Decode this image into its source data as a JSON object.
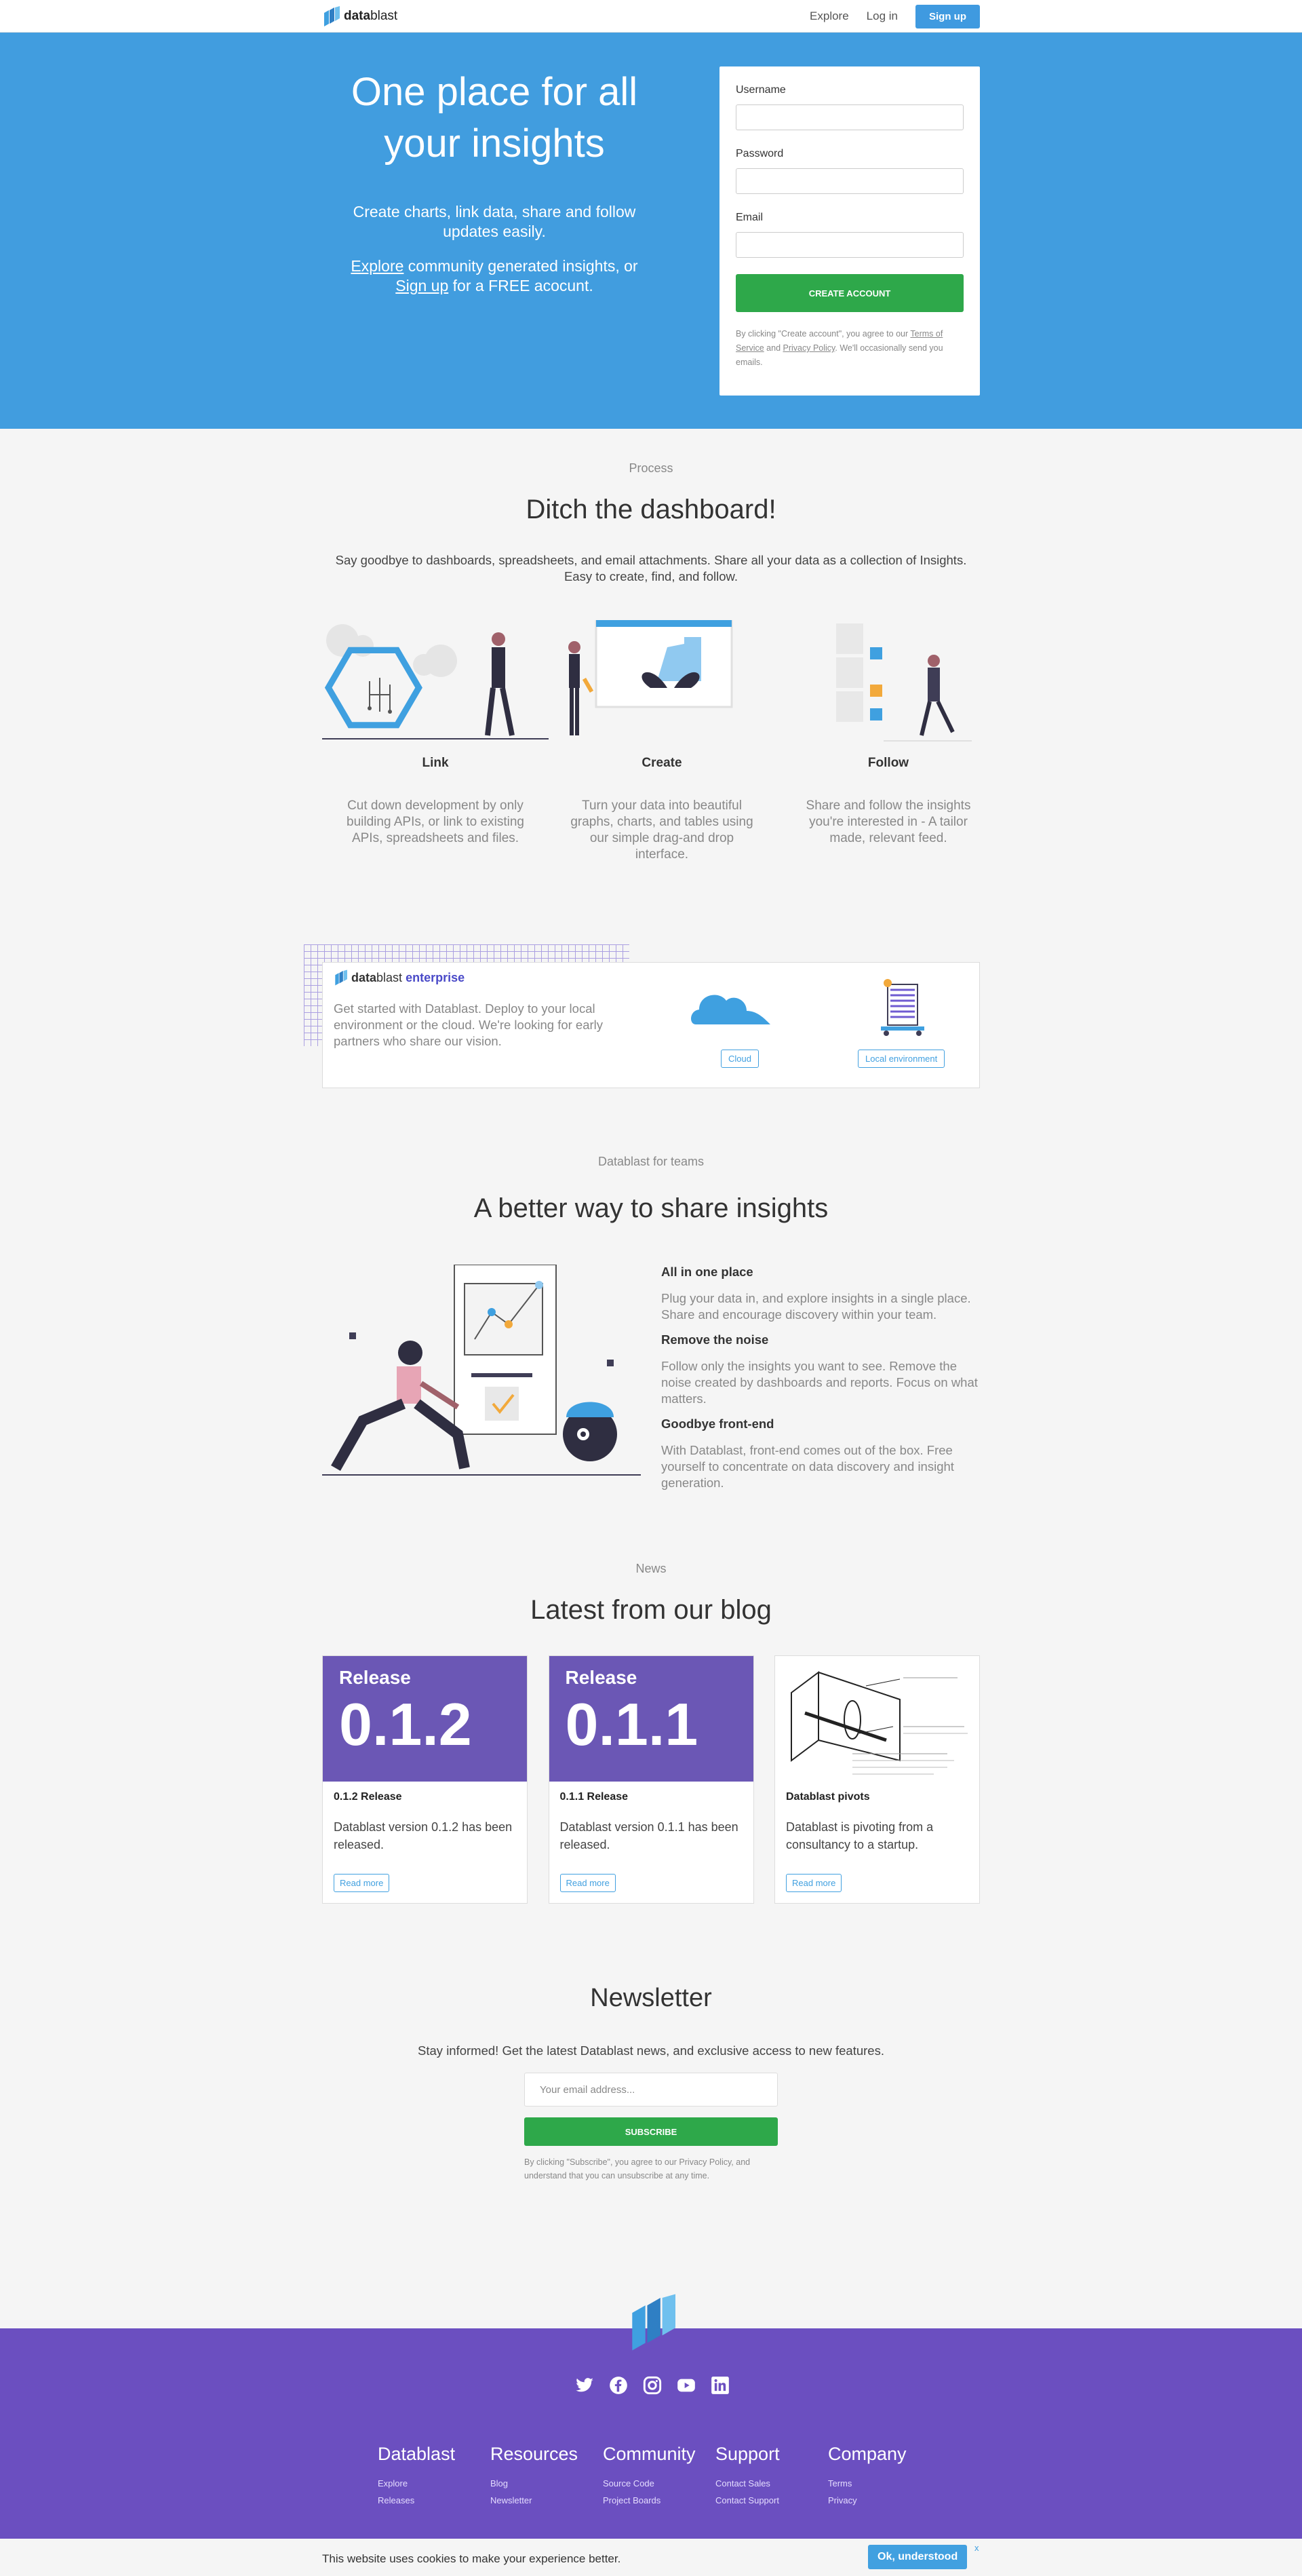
{
  "nav": {
    "brand_bold": "data",
    "brand_rest": "blast",
    "explore": "Explore",
    "login": "Log in",
    "signup": "Sign up"
  },
  "hero": {
    "title": "One place for all your insights",
    "subtitle": "Create charts, link data, share and follow updates easily.",
    "explore_link": "Explore",
    "text_mid": " community generated insights, or ",
    "signup_link": "Sign up",
    "text_end": " for a FREE acocunt."
  },
  "signup_form": {
    "username_label": "Username",
    "password_label": "Password",
    "email_label": "Email",
    "create_button": "CREATE ACCOUNT",
    "terms_pre": "By clicking \"Create account\", you agree to our ",
    "terms_link": "Terms of Service",
    "terms_and": " and ",
    "privacy_link": "Privacy Policy",
    "terms_post": ". We'll occasionally send you emails."
  },
  "process": {
    "eyebrow": "Process",
    "title": "Ditch the dashboard!",
    "lead": "Say goodbye to dashboards, spreadsheets, and email attachments. Share all your data as a collection of Insights. Easy to create, find, and follow.",
    "steps": [
      {
        "title": "Link",
        "text": "Cut down development by only building APIs, or link to existing APIs, spreadsheets and files."
      },
      {
        "title": "Create",
        "text": "Turn your data into beautiful graphs, charts, and tables using our simple drag-and drop interface."
      },
      {
        "title": "Follow",
        "text": "Share and follow the insights you're interested in - A tailor made, relevant feed."
      }
    ]
  },
  "enterprise": {
    "brand_bold": "data",
    "brand_rest": "blast",
    "tag": "enterprise",
    "text": "Get started with Datablast. Deploy to your local environment or the cloud. We're looking for early partners who share our vision.",
    "cloud_button": "Cloud",
    "local_button": "Local environment"
  },
  "teams": {
    "eyebrow": "Datablast for teams",
    "title": "A better way to share insights",
    "features": [
      {
        "title": "All in one place",
        "text": "Plug your data in, and explore insights in a single place. Share and encourage discovery within your team."
      },
      {
        "title": "Remove the noise",
        "text": "Follow only the insights you want to see. Remove the noise created by dashboards and reports. Focus on what matters."
      },
      {
        "title": "Goodbye front-end",
        "text": "With Datablast, front-end comes out of the box. Free yourself to concentrate on data discovery and insight generation."
      }
    ]
  },
  "news": {
    "eyebrow": "News",
    "title": "Latest from our blog",
    "posts": [
      {
        "badge": "Release",
        "version": "0.1.2",
        "title": "0.1.2 Release",
        "text": "Datablast version 0.1.2 has been released.",
        "button": "Read more"
      },
      {
        "badge": "Release",
        "version": "0.1.1",
        "title": "0.1.1 Release",
        "text": "Datablast version 0.1.1 has been released.",
        "button": "Read more"
      },
      {
        "title": "Datablast pivots",
        "text": "Datablast is pivoting from a consultancy to a startup.",
        "button": "Read more"
      }
    ]
  },
  "newsletter": {
    "title": "Newsletter",
    "lead": "Stay informed! Get the latest Datablast news, and exclusive access to new features.",
    "placeholder": "Your email address...",
    "button": "SUBSCRIBE",
    "terms": "By clicking \"Subscribe\", you agree to our Privacy Policy, and understand that you can unsubscribe at any time."
  },
  "footer": {
    "social": [
      "twitter-icon",
      "facebook-icon",
      "instagram-icon",
      "youtube-icon",
      "linkedin-icon"
    ],
    "columns": [
      {
        "title": "Datablast",
        "links": [
          "Explore",
          "Releases"
        ]
      },
      {
        "title": "Resources",
        "links": [
          "Blog",
          "Newsletter"
        ]
      },
      {
        "title": "Community",
        "links": [
          "Source Code",
          "Project Boards"
        ]
      },
      {
        "title": "Support",
        "links": [
          "Contact Sales",
          "Contact Support"
        ]
      },
      {
        "title": "Company",
        "links": [
          "Terms",
          "Privacy"
        ]
      }
    ]
  },
  "cookie": {
    "text": "This website uses cookies to make your experience better.",
    "button": "Ok, understood",
    "close": "x"
  },
  "colors": {
    "hero_blue": "#419ddf",
    "accent_blue": "#3f9ae0",
    "green": "#2ea84a",
    "purple": "#6b57b5",
    "footer_purple": "#6b4fc0"
  }
}
